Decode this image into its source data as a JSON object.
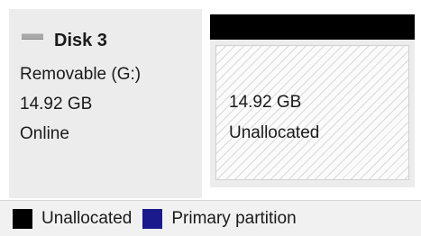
{
  "disk": {
    "name": "Disk 3",
    "type": "Removable (G:)",
    "size": "14.92 GB",
    "status": "Online",
    "icon": "removable-disk-icon"
  },
  "volume": {
    "size": "14.92 GB",
    "state": "Unallocated"
  },
  "legend": {
    "items": [
      {
        "label": "Unallocated",
        "color": "#000000"
      },
      {
        "label": "Primary partition",
        "color": "#1a1a8c"
      }
    ]
  }
}
